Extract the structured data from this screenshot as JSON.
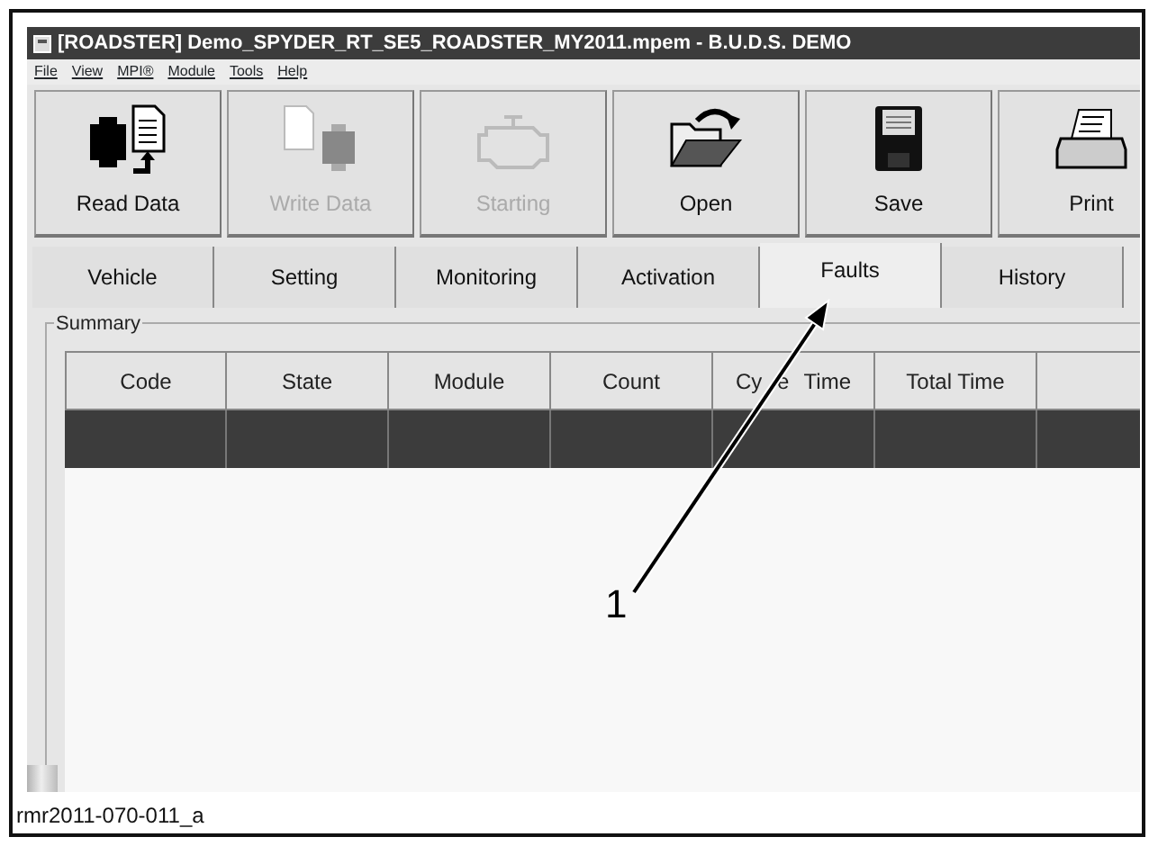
{
  "window": {
    "title": "[ROADSTER] Demo_SPYDER_RT_SE5_ROADSTER_MY2011.mpem - B.U.D.S. DEMO"
  },
  "menu": [
    "File",
    "View",
    "MPI®",
    "Module",
    "Tools",
    "Help"
  ],
  "toolbar": [
    {
      "label": "Read Data",
      "kind": "read",
      "disabled": false
    },
    {
      "label": "Write Data",
      "kind": "write",
      "disabled": true
    },
    {
      "label": "Starting",
      "kind": "engine",
      "disabled": true
    },
    {
      "label": "Open",
      "kind": "open",
      "disabled": false
    },
    {
      "label": "Save",
      "kind": "save",
      "disabled": false
    },
    {
      "label": "Print",
      "kind": "print",
      "disabled": false
    }
  ],
  "tabs": [
    {
      "label": "Vehicle",
      "selected": false
    },
    {
      "label": "Setting",
      "selected": false
    },
    {
      "label": "Monitoring",
      "selected": false
    },
    {
      "label": "Activation",
      "selected": false
    },
    {
      "label": "Faults",
      "selected": true
    },
    {
      "label": "History",
      "selected": false
    }
  ],
  "group": {
    "title": "Summary"
  },
  "table": {
    "columns": [
      "Code",
      "State",
      "Module",
      "Count",
      "Cy e Time",
      "Total Time",
      ""
    ],
    "selected_row": true
  },
  "callout": {
    "label": "1"
  },
  "caption": "rmr2011-070-011_a"
}
